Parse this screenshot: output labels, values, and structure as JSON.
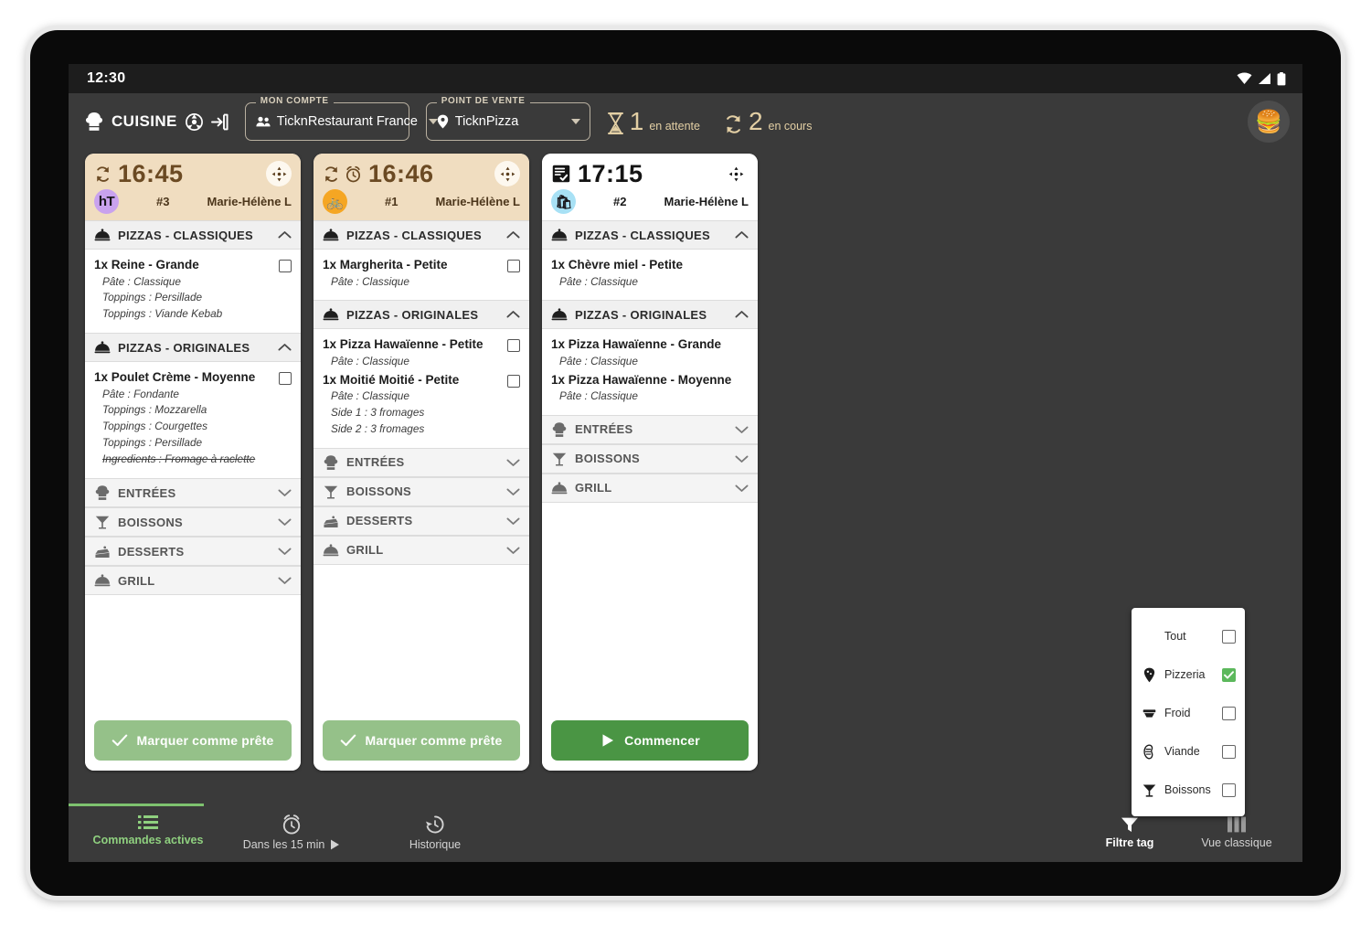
{
  "statusbar": {
    "clock": "12:30",
    "icons": [
      "wifi-icon",
      "signal-icon",
      "battery-icon"
    ]
  },
  "appbar": {
    "brand_label": "CUISINE",
    "brand_icon": "chef-hat-icon",
    "settings_icon": "settings-icon",
    "logout_icon": "logout-icon",
    "account": {
      "legend": "MON COMPTE",
      "value": "TicknRestaurant France",
      "icon": "people-icon"
    },
    "pos": {
      "legend": "POINT DE VENTE",
      "value": "TicknPizza",
      "icon": "location-pin-icon"
    },
    "waiting": {
      "count": "1",
      "label": "en attente",
      "icon": "hourglass-icon"
    },
    "inprogress": {
      "count": "2",
      "label": "en cours",
      "icon": "cycle-icon"
    },
    "avatar_emoji": "🍔"
  },
  "cards": [
    {
      "time": "16:45",
      "head_icons": [
        "cycle-icon"
      ],
      "theme": "beige",
      "badge_kind": "initials",
      "badge_text": "hT",
      "badge_color": "#c9a2ee",
      "order_number": "#3",
      "operator": "Marie-Hélène L",
      "move_icon": "move-arrows-icon",
      "sections": [
        {
          "label": "PIZZAS - CLASSIQUES",
          "icon": "cloche-icon",
          "expanded": true,
          "items": [
            {
              "name": "1x Reine - Grande",
              "checkbox": true,
              "options": [
                {
                  "text": "Pâte : Classique",
                  "struck": false
                },
                {
                  "text": "Toppings : Persillade",
                  "struck": false
                },
                {
                  "text": "Toppings : Viande Kebab",
                  "struck": false
                }
              ]
            }
          ]
        },
        {
          "label": "PIZZAS - ORIGINALES",
          "icon": "cloche-icon",
          "expanded": true,
          "items": [
            {
              "name": "1x Poulet Crème - Moyenne",
              "checkbox": true,
              "options": [
                {
                  "text": "Pâte : Fondante",
                  "struck": false
                },
                {
                  "text": "Toppings : Mozzarella",
                  "struck": false
                },
                {
                  "text": "Toppings : Courgettes",
                  "struck": false
                },
                {
                  "text": "Toppings : Persillade",
                  "struck": false
                },
                {
                  "text": "Ingredients : Fromage à raclette",
                  "struck": true
                }
              ]
            }
          ]
        },
        {
          "label": "ENTRÉES",
          "icon": "chef-hat-icon",
          "expanded": false,
          "items": []
        },
        {
          "label": "BOISSONS",
          "icon": "cocktail-icon",
          "expanded": false,
          "items": []
        },
        {
          "label": "DESSERTS",
          "icon": "cake-icon",
          "expanded": false,
          "items": []
        },
        {
          "label": "GRILL",
          "icon": "cloche-icon",
          "expanded": false,
          "items": []
        }
      ],
      "action": {
        "label": "Marquer comme prête",
        "icon": "check-icon",
        "style": "soft"
      }
    },
    {
      "time": "16:46",
      "head_icons": [
        "cycle-icon",
        "alarm-icon"
      ],
      "theme": "beige",
      "badge_kind": "glyph",
      "badge_text": "🚲",
      "badge_color": "#f5a623",
      "order_number": "#1",
      "operator": "Marie-Hélène L",
      "move_icon": "move-arrows-icon",
      "sections": [
        {
          "label": "PIZZAS - CLASSIQUES",
          "icon": "cloche-icon",
          "expanded": true,
          "items": [
            {
              "name": "1x Margherita - Petite",
              "checkbox": true,
              "options": [
                {
                  "text": "Pâte : Classique",
                  "struck": false
                }
              ]
            }
          ]
        },
        {
          "label": "PIZZAS - ORIGINALES",
          "icon": "cloche-icon",
          "expanded": true,
          "items": [
            {
              "name": "1x Pizza Hawaïenne - Petite",
              "checkbox": true,
              "options": [
                {
                  "text": "Pâte : Classique",
                  "struck": false
                }
              ]
            },
            {
              "name": "1x Moitié Moitié - Petite",
              "checkbox": true,
              "options": [
                {
                  "text": "Pâte : Classique",
                  "struck": false
                },
                {
                  "text": "Side 1 : 3 fromages",
                  "struck": false
                },
                {
                  "text": "Side 2 : 3 fromages",
                  "struck": false
                }
              ]
            }
          ]
        },
        {
          "label": "ENTRÉES",
          "icon": "chef-hat-icon",
          "expanded": false,
          "items": []
        },
        {
          "label": "BOISSONS",
          "icon": "cocktail-icon",
          "expanded": false,
          "items": []
        },
        {
          "label": "DESSERTS",
          "icon": "cake-icon",
          "expanded": false,
          "items": []
        },
        {
          "label": "GRILL",
          "icon": "cloche-icon",
          "expanded": false,
          "items": []
        }
      ],
      "action": {
        "label": "Marquer comme prête",
        "icon": "check-icon",
        "style": "soft"
      }
    },
    {
      "time": "17:15",
      "head_icons": [
        "receipt-check-icon"
      ],
      "theme": "white",
      "badge_kind": "glyph",
      "badge_text": "🛍",
      "badge_color": "#a8e1f5",
      "order_number": "#2",
      "operator": "Marie-Hélène L",
      "move_icon": "move-arrows-icon",
      "sections": [
        {
          "label": "PIZZAS - CLASSIQUES",
          "icon": "cloche-icon",
          "expanded": true,
          "items": [
            {
              "name": "1x Chèvre miel - Petite",
              "checkbox": false,
              "options": [
                {
                  "text": "Pâte : Classique",
                  "struck": false
                }
              ]
            }
          ]
        },
        {
          "label": "PIZZAS - ORIGINALES",
          "icon": "cloche-icon",
          "expanded": true,
          "items": [
            {
              "name": "1x Pizza Hawaïenne - Grande",
              "checkbox": false,
              "options": [
                {
                  "text": "Pâte : Classique",
                  "struck": false
                }
              ]
            },
            {
              "name": "1x Pizza Hawaïenne - Moyenne",
              "checkbox": false,
              "options": [
                {
                  "text": "Pâte : Classique",
                  "struck": false
                }
              ]
            }
          ]
        },
        {
          "label": "ENTRÉES",
          "icon": "chef-hat-icon",
          "expanded": false,
          "items": []
        },
        {
          "label": "BOISSONS",
          "icon": "cocktail-icon",
          "expanded": false,
          "items": []
        },
        {
          "label": "GRILL",
          "icon": "cloche-icon",
          "expanded": false,
          "items": []
        }
      ],
      "action": {
        "label": "Commencer",
        "icon": "play-icon",
        "style": "solid"
      }
    }
  ],
  "filter_panel": {
    "rows": [
      {
        "label": "Tout",
        "icon": null,
        "checked": false
      },
      {
        "label": "Pizzeria",
        "icon": "pizza-slice-icon",
        "checked": true
      },
      {
        "label": "Froid",
        "icon": "fridge-icon",
        "checked": false
      },
      {
        "label": "Viande",
        "icon": "meat-icon",
        "checked": false
      },
      {
        "label": "Boissons",
        "icon": "cocktail-icon",
        "checked": false
      }
    ],
    "accent_checked": "#5cb85c"
  },
  "bottom_nav": {
    "active": {
      "label": "Commandes actives",
      "icon": "list-icon"
    },
    "fifteen": {
      "label": "Dans les 15 min",
      "icon": "alarm-clock-icon",
      "play_icon": "play-icon"
    },
    "history": {
      "label": "Historique",
      "icon": "history-icon"
    },
    "filter_tag": {
      "label": "Filtre tag",
      "icon": "funnel-icon"
    },
    "classic_view": {
      "label": "Vue classique",
      "icon": "columns-icon"
    }
  },
  "system_nav": {
    "back": "back-triangle-icon",
    "home": "home-circle-icon",
    "recents": "recents-square-icon"
  }
}
